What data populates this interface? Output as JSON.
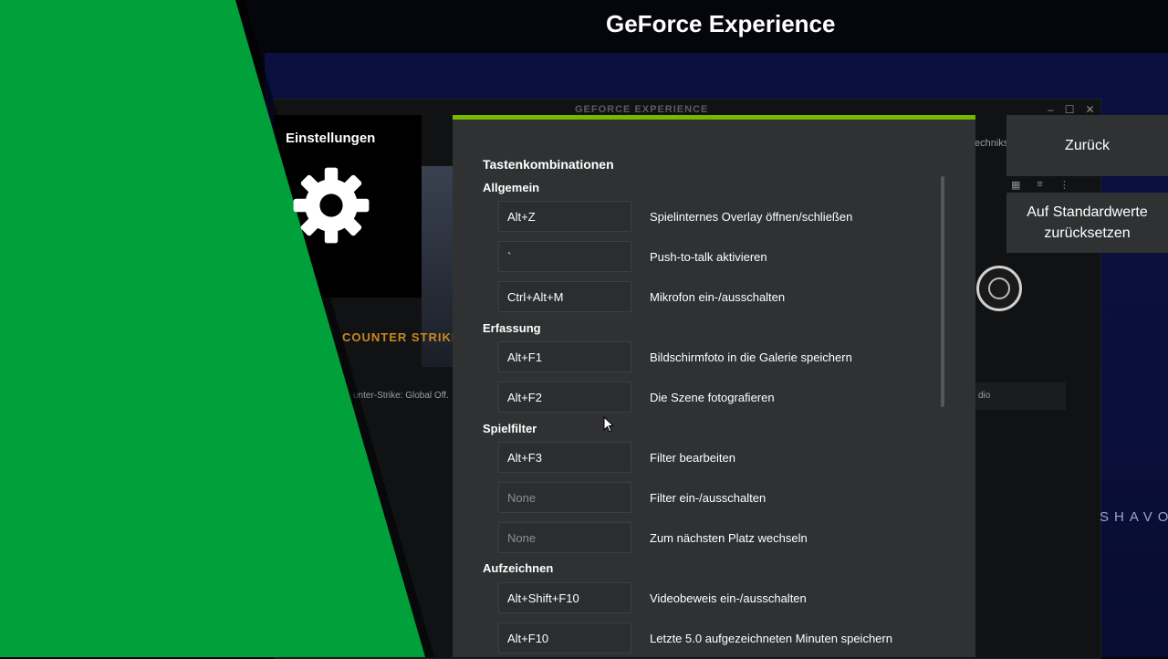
{
  "app_title": "GeForce Experience",
  "background": {
    "window_title": "GEFORCE EXPERIENCE",
    "win_controls": [
      "–",
      "☐",
      "✕"
    ],
    "cs_logo": "COUNTER STRIKE",
    "cs_label": "unter-Strike: Global Off.",
    "right_tab_label": "echniks",
    "right_bar_label": "dio",
    "watermark": "SHAVO"
  },
  "sidebar": {
    "settings_label": "Einstellungen"
  },
  "panel": {
    "title": "Tastenkombinationen",
    "sections": [
      {
        "name": "Allgemein",
        "rows": [
          {
            "key": "Alt+Z",
            "label": "Spielinternes Overlay öffnen/schließen"
          },
          {
            "key": "`",
            "label": "Push-to-talk aktivieren"
          },
          {
            "key": "Ctrl+Alt+M",
            "label": "Mikrofon ein-/ausschalten"
          }
        ]
      },
      {
        "name": "Erfassung",
        "rows": [
          {
            "key": "Alt+F1",
            "label": "Bildschirmfoto in die Galerie speichern"
          },
          {
            "key": "Alt+F2",
            "label": "Die Szene fotografieren"
          }
        ]
      },
      {
        "name": "Spielfilter",
        "rows": [
          {
            "key": "Alt+F3",
            "label": "Filter bearbeiten"
          },
          {
            "key": "None",
            "label": "Filter ein-/ausschalten"
          },
          {
            "key": "None",
            "label": "Zum nächsten Platz wechseln"
          }
        ]
      },
      {
        "name": "Aufzeichnen",
        "rows": [
          {
            "key": "Alt+Shift+F10",
            "label": "Videobeweis ein-/ausschalten"
          },
          {
            "key": "Alt+F10",
            "label": "Letzte 5.0 aufgezeichneten Minuten speichern"
          }
        ]
      }
    ]
  },
  "buttons": {
    "back": "Zurück",
    "reset": "Auf Standardwerte zurücksetzen"
  },
  "colors": {
    "accent": "#76b900",
    "green_bg": "#00a13a",
    "panel_bg": "#2f3133"
  },
  "icons": {
    "settings": "gear-icon",
    "cursor": "mouse-cursor-icon",
    "obs": "obs-logo-icon"
  }
}
